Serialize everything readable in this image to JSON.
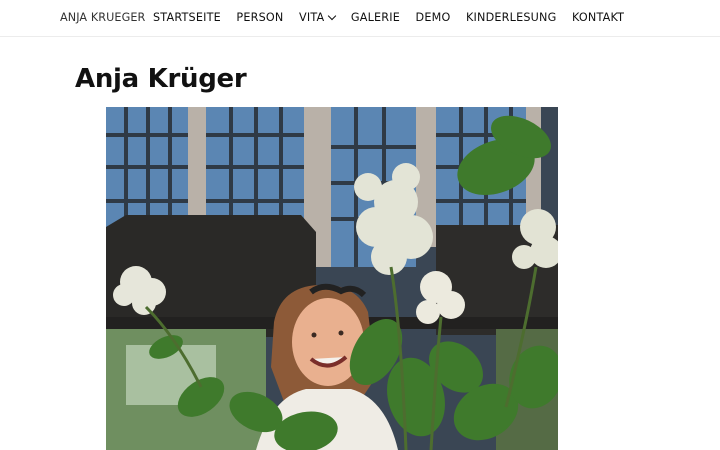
{
  "header": {
    "brand": "ANJA KRUEGER",
    "nav": [
      {
        "label": "STARTSEITE"
      },
      {
        "label": "PERSON"
      },
      {
        "label": "VITA"
      },
      {
        "label": "GALERIE"
      },
      {
        "label": "DEMO"
      },
      {
        "label": "KINDERLESUNG"
      },
      {
        "label": "KONTAKT"
      }
    ]
  },
  "main": {
    "title": "Anja Krüger"
  }
}
